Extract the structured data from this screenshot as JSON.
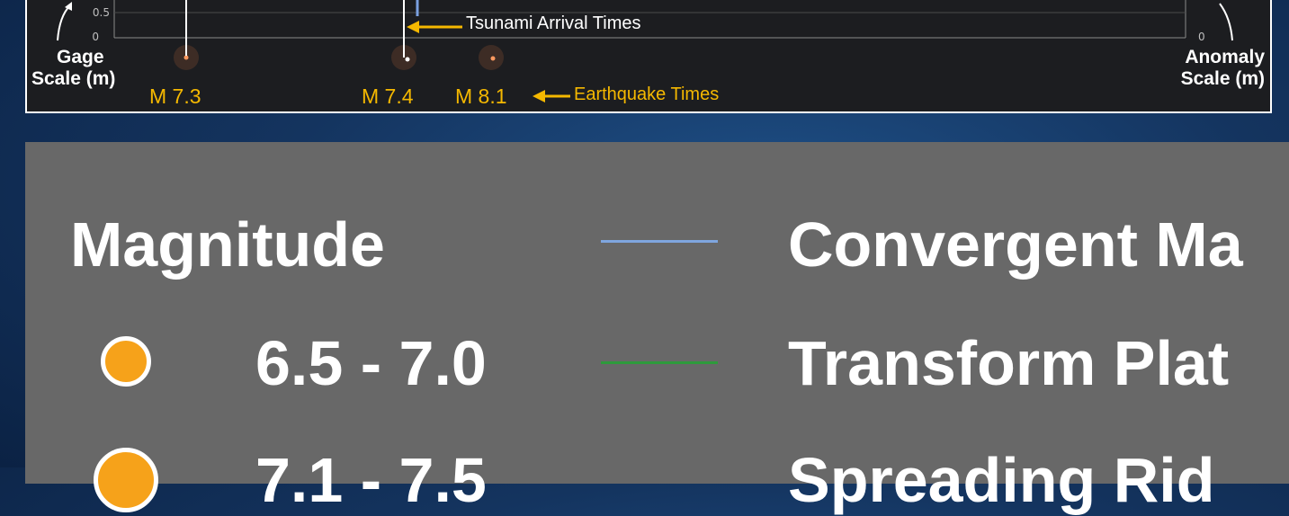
{
  "chart_strip": {
    "left_axis_ticks": [
      "0.5",
      "0"
    ],
    "right_axis_ticks": [
      "0"
    ],
    "left_axis_title": [
      "Gage",
      "Scale (m)"
    ],
    "right_axis_title": [
      "Anomaly",
      "Scale (m)"
    ],
    "earthquakes": [
      {
        "label": "M 7.3"
      },
      {
        "label": "M 7.4"
      },
      {
        "label": "M 8.1"
      }
    ],
    "tsunami_annotation": "Tsunami Arrival Times",
    "earthquake_annotation": "Earthquake Times",
    "colors": {
      "annotation": "#f5b800",
      "trace": "#7aa0e0"
    }
  },
  "legend": {
    "magnitude_title": "Magnitude",
    "magnitude_items": [
      {
        "label": "6.5 - 7.0",
        "color": "#f6a21a"
      },
      {
        "label": "7.1 - 7.5",
        "color": "#f6a21a"
      }
    ],
    "boundary_items": [
      {
        "label": "Convergent Ma",
        "color": "#7fa6df"
      },
      {
        "label": "Transform Plat",
        "color": "#2e9a3c"
      },
      {
        "label": "Spreading Rid",
        "color": "#e0e0e0"
      }
    ]
  }
}
